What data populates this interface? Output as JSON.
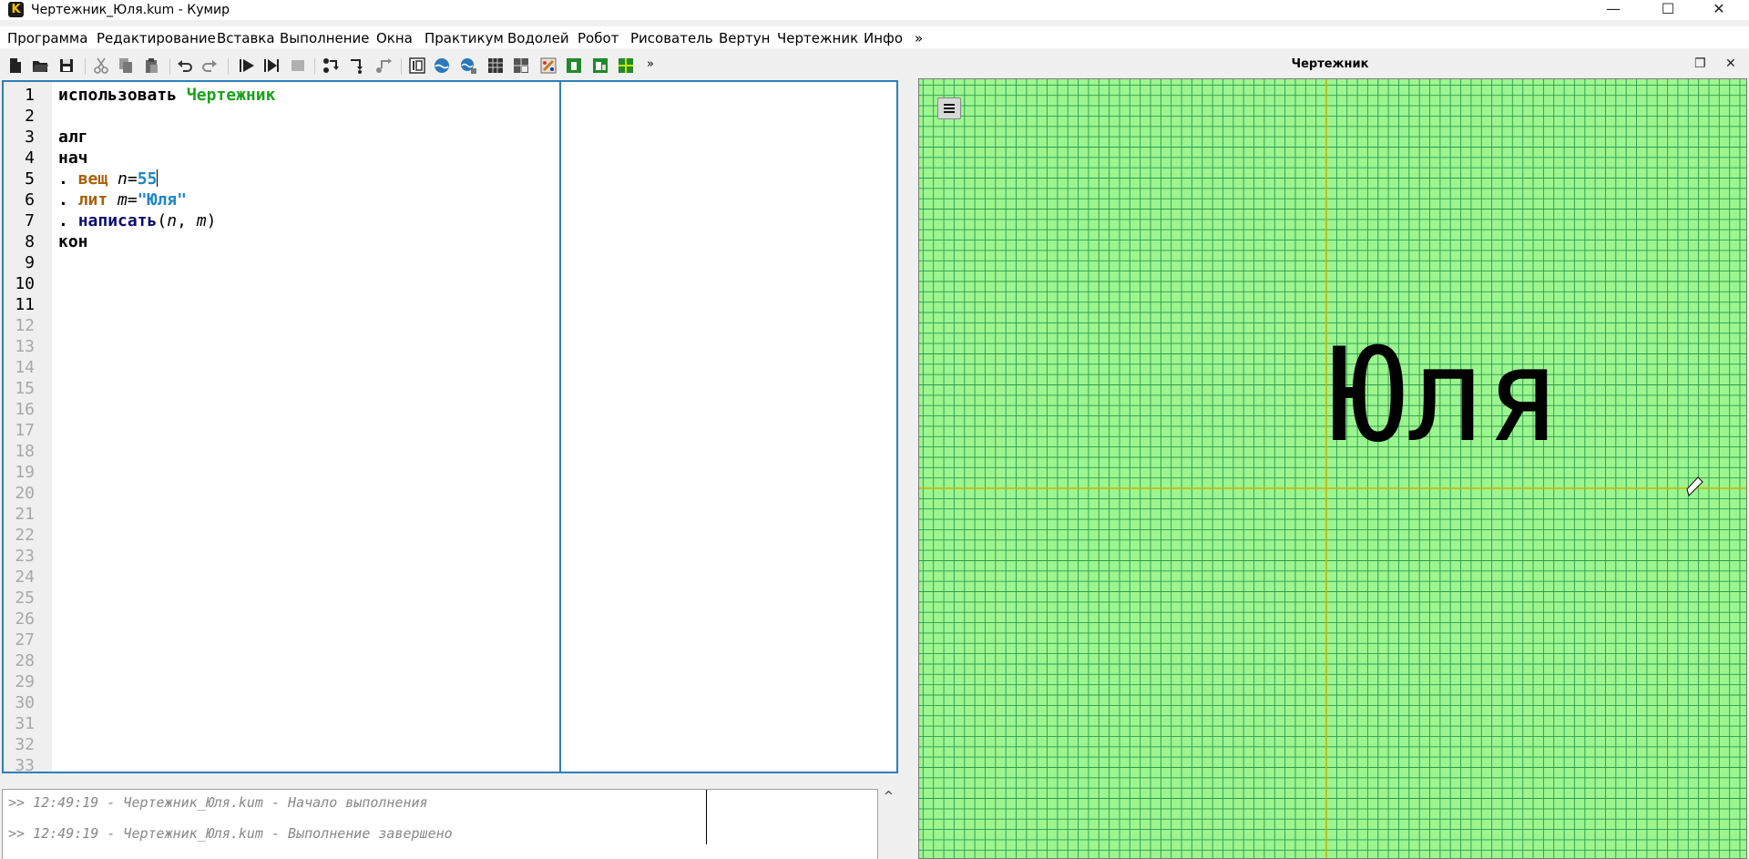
{
  "window": {
    "title": "Чертежник_Юля.kum - Кумир",
    "app_icon_letter": "K",
    "minimize": "—",
    "maximize": "☐",
    "close": "✕"
  },
  "menu": [
    "Программа",
    "Редактирование",
    "Вставка",
    "Выполнение",
    "Окна",
    "Практикум",
    "Водолей",
    "Робот",
    "Рисователь",
    "Вертун",
    "Чертежник",
    "Инфо",
    "»"
  ],
  "toolbar": {
    "overflow": "»",
    "icons": [
      "new-file-icon",
      "open-folder-icon",
      "save-icon",
      "cut-icon",
      "copy-icon",
      "paste-icon",
      "undo-icon",
      "redo-icon",
      "run-icon",
      "run-step-icon",
      "stop-icon",
      "step-into-icon",
      "step-over-icon",
      "step-out-icon",
      "io-icon",
      "water-icon",
      "water2-icon",
      "grid-icon",
      "robot-icon",
      "painter-icon",
      "draw1-icon",
      "draw2-icon",
      "draw3-icon"
    ]
  },
  "editor": {
    "line_numbers": [
      "1",
      "2",
      "3",
      "4",
      "5",
      "6",
      "7",
      "8",
      "9",
      "10",
      "11",
      "12",
      "13",
      "14",
      "15",
      "16",
      "17",
      "18",
      "19",
      "20",
      "21",
      "22",
      "23",
      "24",
      "25",
      "26",
      "27",
      "28",
      "29",
      "30",
      "31",
      "32",
      "33"
    ],
    "code": {
      "l1_kw": "использовать",
      "l1_mod": "Чертежник",
      "l3": "алг",
      "l4": "нач",
      "dot": ".",
      "l5_type": "вещ",
      "l5_var": "n",
      "l5_eq": "=",
      "l5_num": "55",
      "l6_type": "лит",
      "l6_var": "m",
      "l6_eq": "=",
      "l6_str": "\"Юля\"",
      "l7_fn": "написать",
      "l7_open": "(",
      "l7_a": "n",
      "l7_comma": ", ",
      "l7_b": "m",
      "l7_close": ")",
      "l8": "кон"
    }
  },
  "console": {
    "lines": [
      ">> 12:49:19 - Чертежник_Юля.kum - Начало выполнения",
      ">> 12:49:19 - Чертежник_Юля.kum - Выполнение завершено"
    ],
    "scroll_arrow": "^"
  },
  "drawer_panel": {
    "title": "Чертежник",
    "float_icon": "❐",
    "close_icon": "✕",
    "drawn_text": "Юля",
    "grid_color": "#2e9b4e",
    "canvas_color": "#9cf58f",
    "axis_color": "#c8b400"
  }
}
